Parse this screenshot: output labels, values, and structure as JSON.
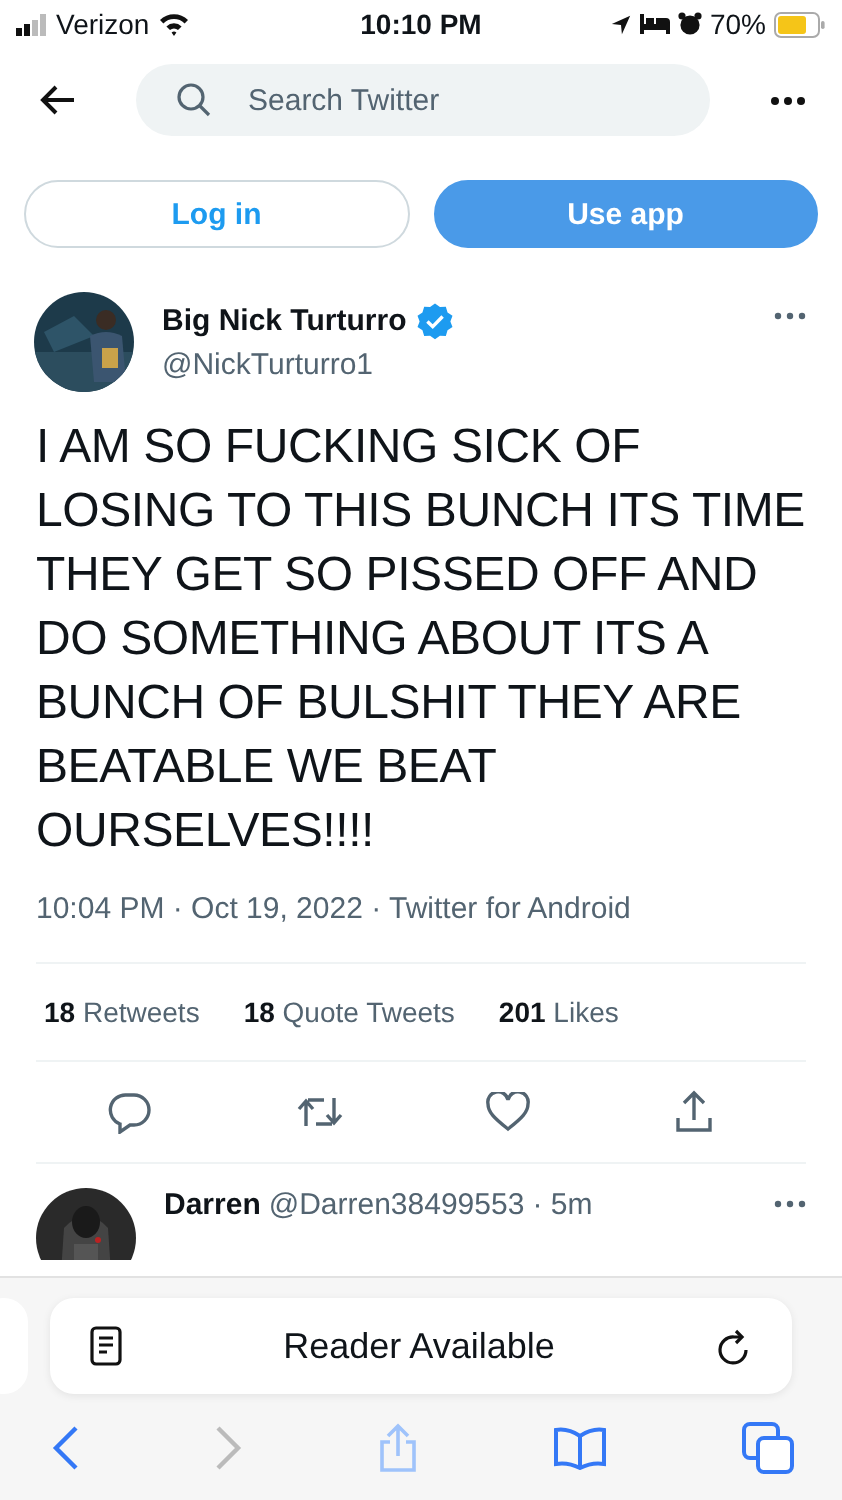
{
  "status_bar": {
    "carrier": "Verizon",
    "time": "10:10 PM",
    "battery": "70%"
  },
  "search": {
    "placeholder": "Search Twitter"
  },
  "buttons": [
    {
      "label": "Log in",
      "kind": "outline"
    },
    {
      "label": "Use app",
      "kind": "filled"
    }
  ],
  "tweet": {
    "name": "Big Nick Turturro",
    "verified": true,
    "handle": "@NickTurturro1",
    "text": "I AM SO FUCKING SICK OF LOSING TO THIS BUNCH ITS TIME THEY GET SO PISSED OFF AND DO SOMETHING ABOUT ITS A BUNCH OF BULSHIT THEY ARE BEATABLE WE BEAT OURSELVES!!!!",
    "meta": "10:04 PM · Oct 19, 2022 · Twitter for Android",
    "stats": [
      {
        "count": "18",
        "label": "Retweets"
      },
      {
        "count": "18",
        "label": "Quote Tweets"
      },
      {
        "count": "201",
        "label": "Likes"
      }
    ]
  },
  "reply": {
    "name": "Darren",
    "handle": "@Darren38499553",
    "time": "· 5m"
  },
  "reader_bar": {
    "label": "Reader Available"
  }
}
